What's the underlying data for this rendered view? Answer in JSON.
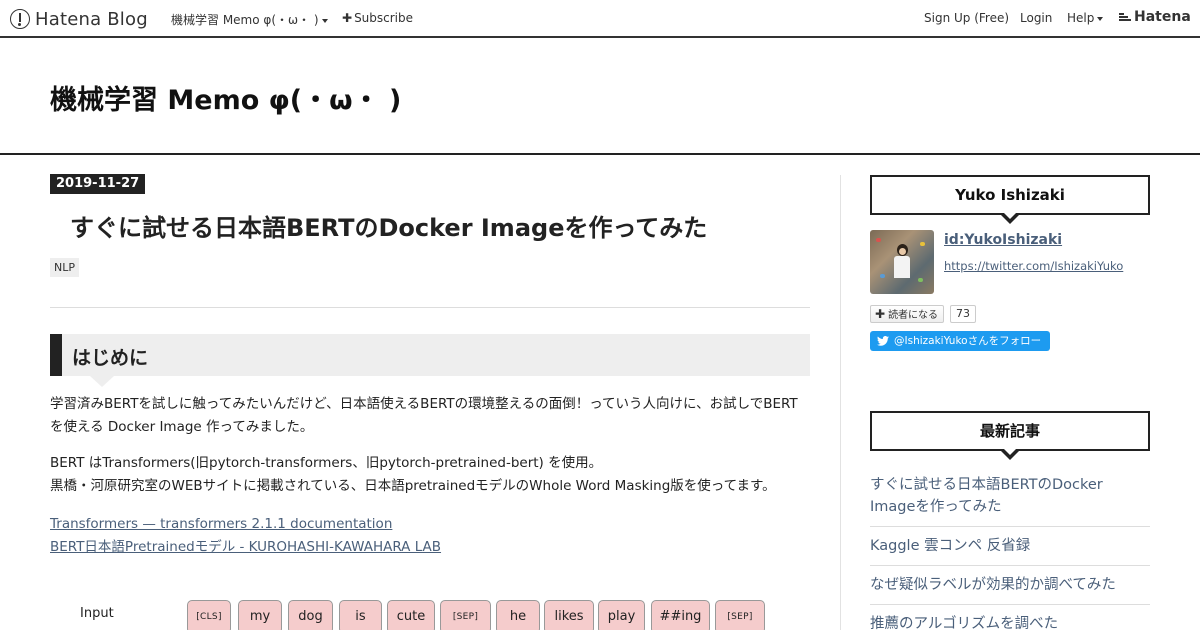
{
  "global_header": {
    "logo_text": "Hatena Blog",
    "blog_menu": "機械学習 Memo φ(・ω・ )",
    "subscribe": "Subscribe",
    "signup": "Sign Up (Free)",
    "login": "Login",
    "help": "Help",
    "hatena": "Hatena"
  },
  "blog": {
    "title": "機械学習 Memo φ(・ω・ )"
  },
  "entry": {
    "date": "2019-11-27",
    "title": "すぐに試せる日本語BERTのDocker Imageを作ってみた",
    "category": "NLP",
    "section_heading": "はじめに",
    "para1": "学習済みBERTを試しに触ってみたいんだけど、日本語使えるBERTの環境整えるの面倒！っていう人向けに、お試しでBERTを使える Docker Image 作ってみました。",
    "para2_line1": "BERT はTransformers(旧pytorch-transformers、旧pytorch-pretrained-bert) を使用。",
    "para2_line2": "黒橋・河原研究室のWEBサイトに掲載されている、日本語pretrainedモデルのWhole Word Masking版を使ってます。",
    "links": [
      "Transformers — transformers 2.1.1 documentation",
      "BERT日本語Pretrainedモデル - KUROHASHI-KAWAHARA LAB"
    ],
    "figure": {
      "label": "Input",
      "tokens": [
        "[CLS]",
        "my",
        "dog",
        "is",
        "cute",
        "[SEP]",
        "he",
        "likes",
        "play",
        "##ing",
        "[SEP]"
      ]
    }
  },
  "sidebar": {
    "profile": {
      "heading": "Yuko Ishizaki",
      "id": "id:YukoIshizaki",
      "url": "https://twitter.com/IshizakiYuko",
      "reader_button": "読者になる",
      "reader_count": "73",
      "twitter_follow": "@IshizakiYukoさんをフォロー"
    },
    "recent": {
      "heading": "最新記事",
      "items": [
        "すぐに試せる日本語BERTのDocker Imageを作ってみた",
        "Kaggle 雲コンペ 反省録",
        "なぜ疑似ラベルが効果的か調べてみた",
        "推薦のアルゴリズムを調べた"
      ]
    }
  },
  "colors": {
    "link": "#4a5f7a",
    "token_fill": "#f5cccc",
    "twitter": "#1d9bf0"
  }
}
